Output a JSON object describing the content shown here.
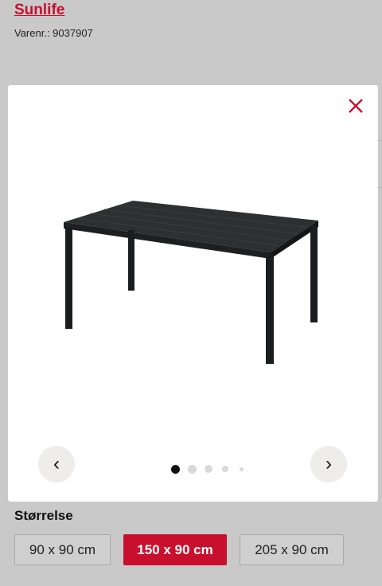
{
  "header": {
    "brand": "Sunlife",
    "sku": "Varenr.: 9037907"
  },
  "gallery": {
    "close_icon": "close-icon",
    "prev_label": "‹",
    "next_label": "›",
    "dot_count": 5,
    "active_dot": 0,
    "accent_color": "#c8102e"
  },
  "size": {
    "title": "Størrelse",
    "options": [
      {
        "label": "90 x 90 cm",
        "selected": false
      },
      {
        "label": "150 x 90 cm",
        "selected": true
      },
      {
        "label": "205 x 90 cm",
        "selected": false
      }
    ]
  }
}
